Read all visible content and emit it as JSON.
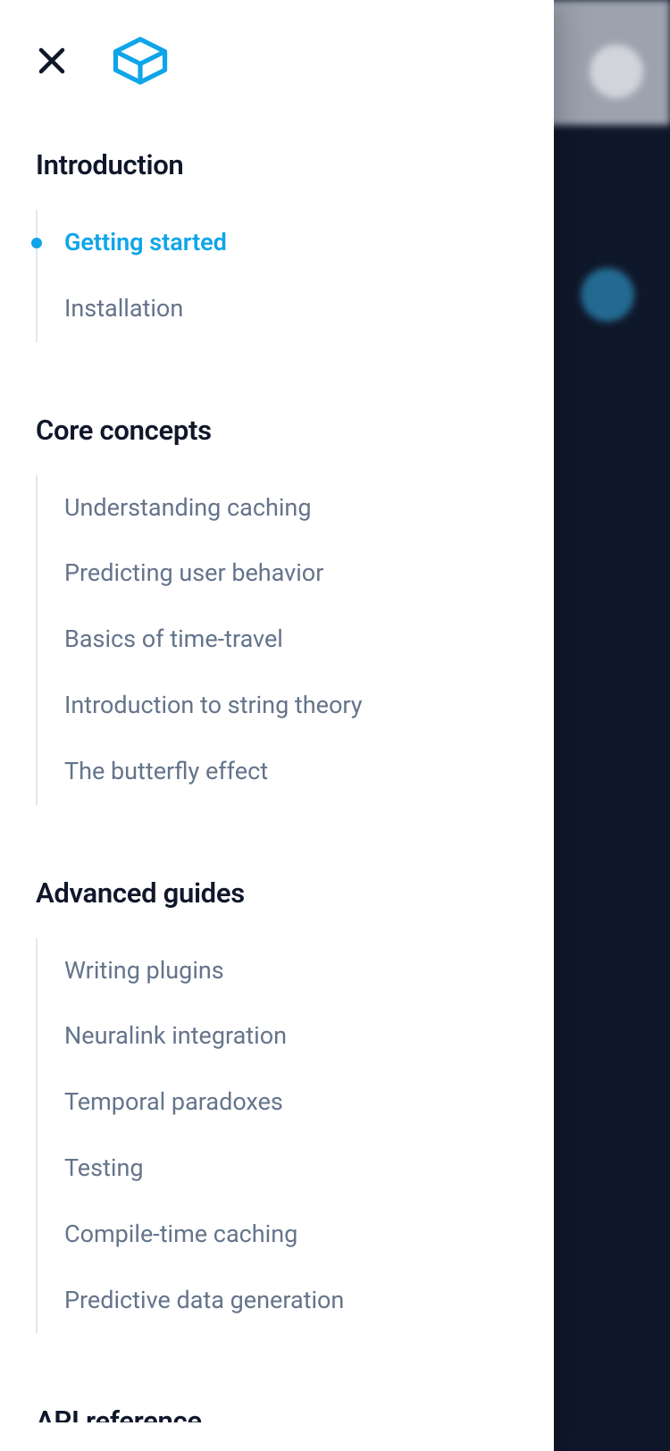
{
  "colors": {
    "accent": "#0ea5e9",
    "textPrimary": "#0f172a",
    "textSecondary": "#64748b"
  },
  "sidebar": {
    "sections": [
      {
        "heading": "Introduction",
        "items": [
          {
            "label": "Getting started",
            "active": true
          },
          {
            "label": "Installation",
            "active": false
          }
        ]
      },
      {
        "heading": "Core concepts",
        "items": [
          {
            "label": "Understanding caching",
            "active": false
          },
          {
            "label": "Predicting user behavior",
            "active": false
          },
          {
            "label": "Basics of time-travel",
            "active": false
          },
          {
            "label": "Introduction to string theory",
            "active": false
          },
          {
            "label": "The butterfly effect",
            "active": false
          }
        ]
      },
      {
        "heading": "Advanced guides",
        "items": [
          {
            "label": "Writing plugins",
            "active": false
          },
          {
            "label": "Neuralink integration",
            "active": false
          },
          {
            "label": "Temporal paradoxes",
            "active": false
          },
          {
            "label": "Testing",
            "active": false
          },
          {
            "label": "Compile-time caching",
            "active": false
          },
          {
            "label": "Predictive data generation",
            "active": false
          }
        ]
      }
    ],
    "nextHeadingPartial": "API reference"
  }
}
